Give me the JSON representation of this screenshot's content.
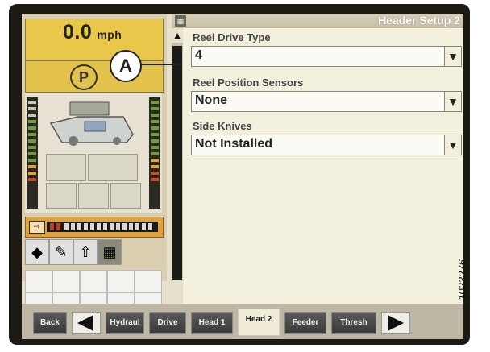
{
  "status": {
    "speed_value": "0.0",
    "speed_unit": "mph",
    "gear": "P"
  },
  "window": {
    "title": "Header Setup 2",
    "scroll_up_icon": "▲"
  },
  "fields": [
    {
      "label": "Reel Drive Type",
      "value": "4"
    },
    {
      "label": "Reel Position Sensors",
      "value": "None"
    },
    {
      "label": "Side Knives",
      "value": "Not Installed"
    }
  ],
  "callout": {
    "label": "A"
  },
  "tabs": [
    {
      "label": "Back"
    },
    {
      "label": "Hydraul"
    },
    {
      "label": "Drive"
    },
    {
      "label": "Head 1"
    },
    {
      "label": "Head 2"
    },
    {
      "label": "Feeder"
    },
    {
      "label": "Thresh"
    }
  ],
  "figure_id": "1023276",
  "icons": {
    "dropdown": "chevron-down-icon",
    "prev": "left-arrow-icon",
    "next": "right-arrow-icon"
  }
}
